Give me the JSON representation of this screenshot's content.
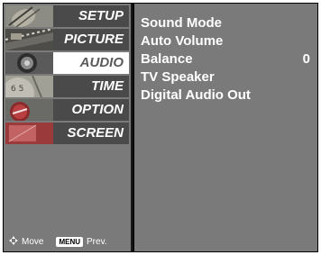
{
  "sidebar": {
    "items": [
      {
        "label": "SETUP",
        "icon": "satellite-dish-icon",
        "selected": false
      },
      {
        "label": "PICTURE",
        "icon": "film-strip-icon",
        "selected": false
      },
      {
        "label": "AUDIO",
        "icon": "speaker-icon",
        "selected": true
      },
      {
        "label": "TIME",
        "icon": "clock-icon",
        "selected": false
      },
      {
        "label": "OPTION",
        "icon": "special-badge-icon",
        "selected": false
      },
      {
        "label": "SCREEN",
        "icon": "screen-icon",
        "selected": false
      }
    ],
    "hint_move": "Move",
    "hint_menu_key": "MENU",
    "hint_prev": "Prev."
  },
  "options": [
    {
      "label": "Sound Mode",
      "value": ""
    },
    {
      "label": "Auto Volume",
      "value": ""
    },
    {
      "label": "Balance",
      "value": "0"
    },
    {
      "label": "TV Speaker",
      "value": ""
    },
    {
      "label": "Digital Audio Out",
      "value": ""
    }
  ],
  "colors": {
    "panel": "#7a7a7a",
    "bar": "#4a4a4a",
    "selected_bar": "#ffffff",
    "frame": "#000000"
  }
}
